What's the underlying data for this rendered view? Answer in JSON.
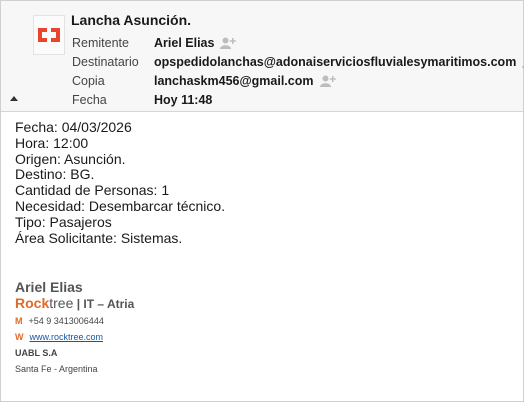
{
  "header": {
    "subject": "Lancha Asunción.",
    "fields": {
      "remitente": {
        "label": "Remitente",
        "value": "Ariel Elias"
      },
      "destinatario": {
        "label": "Destinatario",
        "value": "opspedidolanchas@adonaiserviciosfluvialesymaritimos.com"
      },
      "copia": {
        "label": "Copia",
        "value": "lanchaskm456@gmail.com"
      },
      "fecha": {
        "label": "Fecha",
        "value": "Hoy 11:48"
      }
    },
    "avatar_icon": "rocktree-logo-icon",
    "add_contact_icon": "add-contact-icon",
    "collapse_icon": "collapse-up-icon"
  },
  "body": {
    "lines": [
      "Fecha: 04/03/2026",
      "Hora: 12:00",
      "Origen: Asunción.",
      "Destino: BG.",
      "Cantidad de Personas: 1",
      "Necesidad: Desembarcar técnico.",
      "Tipo: Pasajeros",
      "Área Solicitante: Sistemas."
    ]
  },
  "signature": {
    "name": "Ariel Elias",
    "brand_rock": "Rock",
    "brand_tree": "tree",
    "brand_suffix": " | IT – Atria",
    "mobile_letter": "M",
    "mobile": "+54 9 3413006444",
    "web_letter": "W",
    "web": "www.rocktree.com",
    "company": "UABL S.A",
    "location": "Santa Fe - Argentina"
  },
  "colors": {
    "accent": "#e06a2b",
    "link": "#1a56a8",
    "header_bg": "#f7f7f7"
  }
}
